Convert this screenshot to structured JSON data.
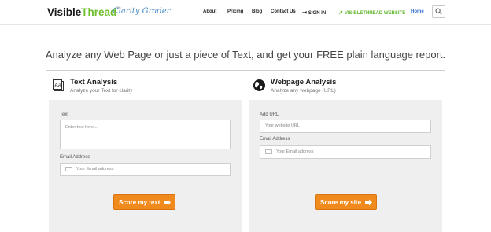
{
  "header": {
    "logo_main": "Visible",
    "logo_accent": "Thread",
    "logo_tm": "™",
    "logo_sub": "Clarity Grader",
    "nav": {
      "about": "About",
      "pricing": "Pricing",
      "blog": "Blog",
      "contact": "Contact Us",
      "signin": "SIGN IN",
      "website": "VISIBLETHREAD WEBSITE",
      "home": "Home"
    },
    "colors": {
      "accent_green": "#6fbf2d",
      "link_blue": "#2f6fd0",
      "cta_orange": "#f08a1c"
    }
  },
  "main": {
    "headline": "Analyze any Web Page or just a piece of Text, and get your FREE plain language report."
  },
  "text_analysis": {
    "icon": "document-text-icon",
    "title": "Text Analysis",
    "subtitle": "Analyze your Text for clarity",
    "text_label": "Text",
    "text_placeholder": "Enter text here...",
    "email_label": "Email Address",
    "email_placeholder": "Your Email address",
    "button_label": "Score my text"
  },
  "webpage_analysis": {
    "icon": "globe-icon",
    "title": "Webpage Analysis",
    "subtitle": "Analyze any webpage (URL)",
    "url_label": "Add URL",
    "url_placeholder": "Your website URL",
    "email_label": "Email Address",
    "email_placeholder": "Your Email address",
    "button_label": "Score my site"
  }
}
